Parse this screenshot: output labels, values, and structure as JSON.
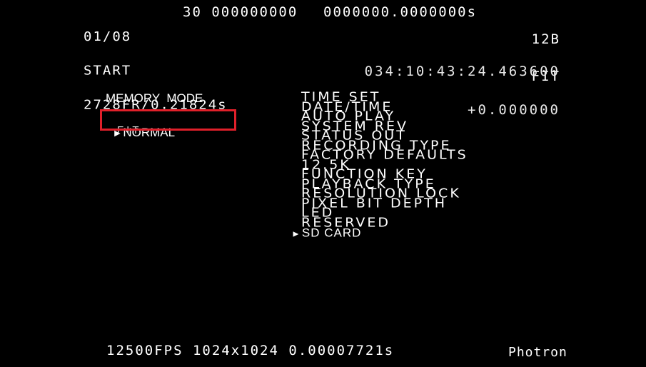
{
  "status": {
    "counter": "01/08",
    "trigger_mode": "START",
    "record_info": "2728FR/0.21824s",
    "frame_number": "30 000000000",
    "elapsed_time": "0000000.0000000s",
    "bit_depth": "12B",
    "memory_mode_indicator": "FIT",
    "clock_time": "034:10:43:24.463600",
    "offset_time": "+0.000000"
  },
  "memory_mode_menu": {
    "title": "MEMORY  MODE",
    "options": [
      {
        "label": "NORMAL",
        "selected": true
      },
      {
        "label": "FIT",
        "selected": false
      }
    ],
    "selection_arrow": "►",
    "highlight_color": "#e0202a"
  },
  "main_menu": {
    "items": [
      "TIME SET",
      "DATE/TIME",
      "AUTO PLAY",
      "SYSTEM REV",
      "STATUS OUT",
      "RECORDING TYPE",
      "FACTORY DEFAULTS",
      "12.5K",
      "FUNCTION KEY",
      "PLAYBACK TYPE",
      "RESOLUTION LOCK",
      "PIXEL BIT DEPTH",
      "LED",
      "RESERVED",
      "SD CARD"
    ],
    "current_item": "SD CARD",
    "current_arrow": "►"
  },
  "footer": {
    "frame_rate": "12500FPS",
    "resolution": "1024x1024",
    "shutter": "0.00007721s",
    "brand": "Photron"
  }
}
